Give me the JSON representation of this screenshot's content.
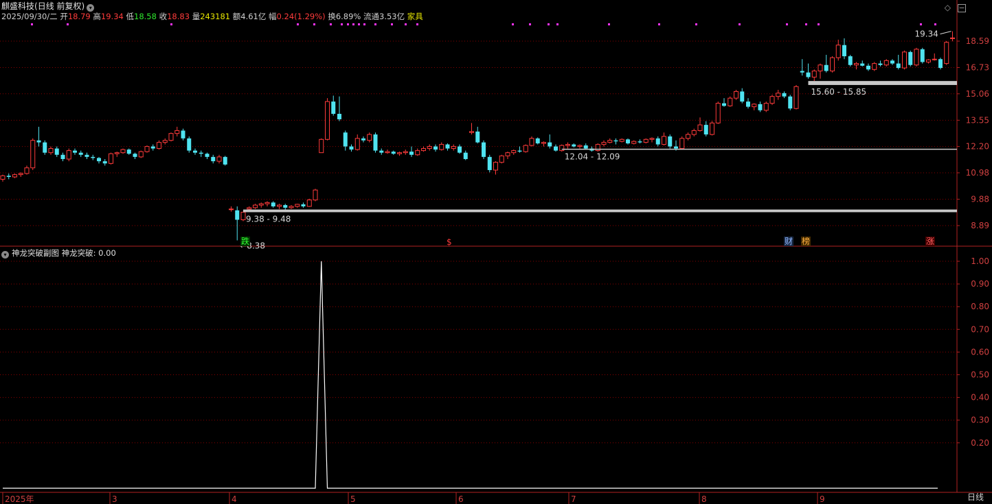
{
  "header": {
    "stock_name": "麒盛科技",
    "period_mode": "(日线 前复权)",
    "date": "2025/09/30/二",
    "open_label": "开",
    "open": "18.79",
    "high_label": "高",
    "high": "19.34",
    "low_label": "低",
    "low": "18.58",
    "close_label": "收",
    "close": "18.83",
    "volume_label": "量",
    "volume": "243181",
    "amount_label": "额",
    "amount": "4.61亿",
    "change_label": "幅",
    "change": "0.24(1.29%)",
    "turnover_label": "换",
    "turnover": "6.89%",
    "float_label": "流通",
    "float": "3.53亿",
    "industry": "家具"
  },
  "sub_chart": {
    "title": "神龙突破副图",
    "indicator": "神龙突破: 0.00"
  },
  "price_axis": [
    "18.59",
    "16.73",
    "15.06",
    "13.55",
    "12.20",
    "10.98",
    "9.88",
    "8.89"
  ],
  "indicator_axis": [
    "1.00",
    "0.90",
    "0.80",
    "0.70",
    "0.60",
    "0.50",
    "0.40",
    "0.30",
    "0.20"
  ],
  "month_axis": [
    "2025年",
    "3",
    "4",
    "5",
    "6",
    "7",
    "8",
    "9"
  ],
  "period_label": "日线",
  "annotations": {
    "max_price": "19.34",
    "min_price": "8.38",
    "gap1": "9.38 - 9.48",
    "gap2": "12.04 - 12.09",
    "gap3": "15.60 - 15.85"
  },
  "markers": {
    "fall": "跌",
    "dollar": "$",
    "finance": "财",
    "rank": "榜",
    "rise": "涨"
  },
  "chart_data": {
    "type": "candlestick",
    "candles": [
      [
        10.7,
        10.9,
        10.6,
        10.85
      ],
      [
        10.85,
        10.95,
        10.7,
        10.8
      ],
      [
        10.8,
        10.95,
        10.75,
        10.9
      ],
      [
        10.9,
        11.0,
        10.8,
        10.95
      ],
      [
        10.95,
        11.3,
        10.9,
        11.2
      ],
      [
        11.2,
        12.6,
        11.1,
        12.5
      ],
      [
        12.5,
        13.2,
        12.2,
        12.4
      ],
      [
        12.4,
        12.5,
        11.8,
        11.9
      ],
      [
        11.9,
        12.2,
        11.8,
        12.1
      ],
      [
        12.1,
        12.2,
        11.7,
        11.8
      ],
      [
        11.8,
        11.9,
        11.5,
        11.6
      ],
      [
        11.6,
        12.1,
        11.5,
        12.0
      ],
      [
        12.0,
        12.1,
        11.8,
        11.9
      ],
      [
        11.9,
        12.0,
        11.7,
        11.8
      ],
      [
        11.8,
        11.9,
        11.6,
        11.7
      ],
      [
        11.7,
        11.8,
        11.55,
        11.65
      ],
      [
        11.65,
        11.7,
        11.4,
        11.5
      ],
      [
        11.5,
        11.6,
        11.3,
        11.4
      ],
      [
        11.4,
        11.9,
        11.35,
        11.85
      ],
      [
        11.85,
        11.95,
        11.7,
        11.9
      ],
      [
        11.9,
        12.1,
        11.85,
        12.05
      ],
      [
        12.05,
        12.1,
        11.8,
        11.85
      ],
      [
        11.85,
        11.9,
        11.6,
        11.7
      ],
      [
        11.7,
        12.0,
        11.65,
        11.95
      ],
      [
        11.95,
        12.25,
        11.9,
        12.2
      ],
      [
        12.2,
        12.3,
        12.0,
        12.1
      ],
      [
        12.1,
        12.5,
        12.05,
        12.4
      ],
      [
        12.4,
        12.6,
        12.3,
        12.5
      ],
      [
        12.5,
        12.9,
        12.45,
        12.85
      ],
      [
        12.85,
        13.2,
        12.7,
        13.0
      ],
      [
        13.0,
        13.1,
        12.5,
        12.6
      ],
      [
        12.6,
        12.7,
        11.9,
        12.0
      ],
      [
        12.0,
        12.1,
        11.8,
        11.9
      ],
      [
        11.9,
        12.0,
        11.7,
        11.85
      ],
      [
        11.85,
        11.9,
        11.6,
        11.7
      ],
      [
        11.7,
        11.8,
        11.4,
        11.5
      ],
      [
        11.5,
        11.8,
        11.4,
        11.7
      ],
      [
        11.7,
        11.75,
        11.3,
        11.35
      ],
      [
        9.5,
        9.6,
        9.4,
        9.5
      ],
      [
        9.45,
        9.6,
        8.38,
        9.1
      ],
      [
        9.1,
        9.4,
        9.05,
        9.38
      ],
      [
        9.5,
        9.6,
        9.4,
        9.55
      ],
      [
        9.55,
        9.7,
        9.5,
        9.65
      ],
      [
        9.65,
        9.75,
        9.55,
        9.7
      ],
      [
        9.7,
        9.8,
        9.6,
        9.75
      ],
      [
        9.75,
        9.8,
        9.55,
        9.6
      ],
      [
        9.6,
        9.7,
        9.5,
        9.65
      ],
      [
        9.65,
        9.7,
        9.45,
        9.55
      ],
      [
        9.55,
        9.65,
        9.5,
        9.6
      ],
      [
        9.6,
        9.7,
        9.55,
        9.68
      ],
      [
        9.68,
        9.75,
        9.55,
        9.6
      ],
      [
        9.6,
        9.9,
        9.58,
        9.85
      ],
      [
        9.85,
        10.3,
        9.8,
        10.25
      ],
      [
        11.9,
        12.6,
        11.9,
        12.55
      ],
      [
        12.55,
        14.8,
        12.5,
        14.6
      ],
      [
        14.6,
        14.95,
        13.8,
        13.9
      ],
      [
        13.9,
        14.9,
        13.5,
        13.6
      ],
      [
        12.9,
        13.0,
        12.0,
        12.2
      ],
      [
        12.2,
        12.3,
        11.95,
        12.05
      ],
      [
        12.05,
        12.8,
        12.0,
        12.6
      ],
      [
        12.6,
        12.7,
        12.4,
        12.5
      ],
      [
        12.5,
        12.9,
        12.4,
        12.8
      ],
      [
        12.8,
        12.9,
        11.9,
        12.0
      ],
      [
        12.0,
        12.1,
        11.8,
        11.9
      ],
      [
        11.9,
        12.05,
        11.85,
        11.95
      ],
      [
        11.95,
        12.0,
        11.8,
        11.85
      ],
      [
        11.85,
        11.95,
        11.75,
        11.9
      ],
      [
        11.9,
        12.05,
        11.8,
        11.95
      ],
      [
        11.95,
        12.2,
        11.7,
        11.8
      ],
      [
        11.8,
        12.1,
        11.75,
        12.0
      ],
      [
        12.0,
        12.2,
        11.95,
        12.1
      ],
      [
        12.1,
        12.3,
        12.0,
        12.2
      ],
      [
        12.2,
        12.3,
        11.95,
        12.05
      ],
      [
        12.05,
        12.4,
        12.0,
        12.3
      ],
      [
        12.3,
        12.35,
        12.0,
        12.1
      ],
      [
        12.1,
        12.3,
        12.0,
        12.2
      ],
      [
        12.2,
        12.3,
        11.85,
        11.9
      ],
      [
        11.9,
        12.0,
        11.55,
        11.6
      ],
      [
        12.9,
        13.4,
        12.8,
        12.95
      ],
      [
        12.95,
        13.2,
        12.35,
        12.4
      ],
      [
        12.4,
        12.5,
        11.6,
        11.7
      ],
      [
        11.7,
        11.8,
        11.0,
        11.1
      ],
      [
        11.1,
        11.5,
        10.9,
        11.45
      ],
      [
        11.45,
        11.8,
        11.4,
        11.75
      ],
      [
        11.75,
        11.95,
        11.6,
        11.9
      ],
      [
        11.9,
        12.05,
        11.8,
        12.0
      ],
      [
        12.0,
        12.2,
        11.9,
        11.95
      ],
      [
        11.95,
        12.3,
        11.9,
        12.25
      ],
      [
        12.25,
        12.7,
        12.2,
        12.6
      ],
      [
        12.6,
        12.65,
        12.3,
        12.35
      ],
      [
        12.35,
        12.45,
        12.2,
        12.4
      ],
      [
        12.4,
        12.8,
        12.1,
        12.2
      ],
      [
        12.2,
        12.3,
        11.95,
        12.0
      ],
      [
        12.0,
        12.3,
        11.95,
        12.25
      ],
      [
        12.25,
        12.4,
        12.1,
        12.3
      ],
      [
        12.3,
        12.35,
        12.15,
        12.2
      ],
      [
        12.2,
        12.3,
        12.1,
        12.25
      ],
      [
        12.25,
        12.35,
        12.05,
        12.1
      ],
      [
        12.1,
        12.2,
        11.95,
        12.0
      ],
      [
        12.0,
        12.35,
        11.95,
        12.3
      ],
      [
        12.3,
        12.5,
        12.2,
        12.4
      ],
      [
        12.4,
        12.6,
        12.35,
        12.5
      ],
      [
        12.5,
        12.6,
        12.3,
        12.45
      ],
      [
        12.45,
        12.6,
        12.4,
        12.55
      ],
      [
        12.55,
        12.6,
        12.3,
        12.35
      ],
      [
        12.35,
        12.5,
        12.3,
        12.45
      ],
      [
        12.45,
        12.55,
        12.35,
        12.4
      ],
      [
        12.4,
        12.6,
        12.35,
        12.55
      ],
      [
        12.55,
        12.65,
        12.4,
        12.6
      ],
      [
        12.6,
        12.7,
        12.2,
        12.3
      ],
      [
        12.3,
        12.9,
        12.25,
        12.7
      ],
      [
        12.7,
        12.8,
        12.1,
        12.2
      ],
      [
        12.2,
        12.5,
        12.0,
        12.1
      ],
      [
        12.1,
        12.7,
        12.05,
        12.6
      ],
      [
        12.6,
        12.9,
        12.5,
        12.8
      ],
      [
        12.8,
        13.1,
        12.7,
        13.0
      ],
      [
        13.0,
        13.7,
        12.95,
        13.3
      ],
      [
        13.3,
        13.5,
        12.7,
        12.8
      ],
      [
        12.8,
        13.5,
        12.75,
        13.4
      ],
      [
        13.4,
        14.6,
        13.35,
        14.5
      ],
      [
        14.5,
        14.8,
        14.3,
        14.35
      ],
      [
        14.35,
        14.9,
        14.3,
        14.8
      ],
      [
        14.8,
        15.3,
        14.7,
        15.2
      ],
      [
        15.2,
        15.4,
        14.5,
        14.6
      ],
      [
        14.6,
        14.8,
        14.2,
        14.3
      ],
      [
        14.3,
        14.5,
        14.1,
        14.45
      ],
      [
        14.45,
        14.6,
        14.0,
        14.1
      ],
      [
        14.1,
        14.6,
        14.0,
        14.5
      ],
      [
        14.5,
        15.0,
        14.4,
        14.9
      ],
      [
        14.9,
        15.3,
        14.7,
        15.1
      ],
      [
        15.1,
        15.2,
        14.8,
        14.9
      ],
      [
        14.9,
        15.0,
        14.1,
        14.2
      ],
      [
        14.2,
        15.6,
        14.15,
        15.5
      ],
      [
        16.5,
        17.3,
        16.2,
        16.4
      ],
      [
        16.4,
        17.0,
        16.0,
        16.1
      ],
      [
        16.1,
        16.6,
        15.85,
        16.5
      ],
      [
        16.5,
        17.0,
        16.0,
        16.9
      ],
      [
        16.9,
        17.6,
        16.4,
        16.5
      ],
      [
        16.5,
        17.5,
        16.4,
        17.4
      ],
      [
        17.4,
        18.7,
        17.2,
        18.3
      ],
      [
        18.3,
        18.8,
        17.3,
        17.5
      ],
      [
        17.5,
        17.6,
        16.8,
        16.9
      ],
      [
        16.9,
        17.1,
        16.6,
        17.0
      ],
      [
        17.0,
        17.2,
        16.8,
        16.85
      ],
      [
        16.85,
        17.0,
        16.5,
        16.6
      ],
      [
        16.6,
        17.1,
        16.5,
        17.0
      ],
      [
        17.0,
        17.2,
        16.8,
        16.9
      ],
      [
        16.9,
        17.3,
        16.8,
        17.2
      ],
      [
        17.2,
        17.3,
        16.9,
        17.0
      ],
      [
        17.0,
        17.6,
        16.6,
        16.7
      ],
      [
        16.7,
        17.9,
        16.6,
        17.8
      ],
      [
        17.8,
        17.9,
        16.8,
        16.9
      ],
      [
        16.9,
        18.1,
        16.8,
        18.0
      ],
      [
        18.0,
        18.1,
        17.0,
        17.1
      ],
      [
        17.1,
        17.3,
        17.0,
        17.25
      ],
      [
        17.25,
        17.7,
        17.2,
        17.3
      ],
      [
        17.3,
        17.4,
        16.6,
        16.7
      ],
      [
        17.0,
        18.6,
        16.9,
        18.5
      ],
      [
        18.79,
        19.34,
        18.58,
        18.83
      ]
    ],
    "indicator": {
      "spike_index": 53,
      "spike_value": 1.0
    },
    "gaps": [
      [
        9.38,
        9.48
      ],
      [
        12.04,
        12.09
      ],
      [
        15.6,
        15.85
      ]
    ]
  },
  "colors": {
    "up": "#ff3b3b",
    "down": "#4fe3f0",
    "grid": "#8b0000",
    "axis": "#b22222",
    "white": "#ffffff",
    "magenta": "#ff33ff"
  }
}
